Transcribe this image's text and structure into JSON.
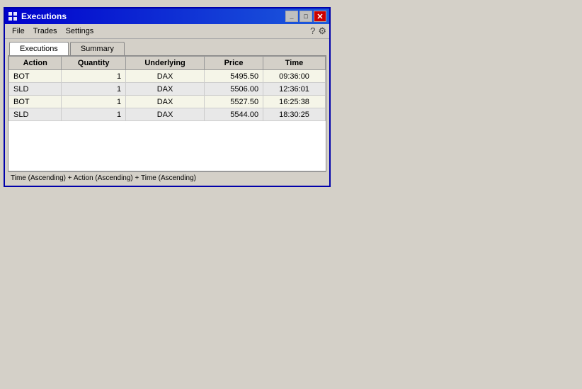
{
  "window": {
    "title": "Executions",
    "icon": "▦"
  },
  "title_buttons": {
    "minimize": "_",
    "maximize": "□",
    "close": "✕"
  },
  "menu": {
    "items": [
      "File",
      "Trades",
      "Settings"
    ],
    "help_icon": "?",
    "tool_icon": "🔧"
  },
  "tabs": [
    {
      "label": "Executions",
      "active": true
    },
    {
      "label": "Summary",
      "active": false
    }
  ],
  "table": {
    "columns": [
      "Action",
      "Quantity",
      "Underlying",
      "Price",
      "Time"
    ],
    "rows": [
      {
        "action": "BOT",
        "quantity": "1",
        "underlying": "DAX",
        "price": "5495.50",
        "time": "09:36:00",
        "style": "odd"
      },
      {
        "action": "SLD",
        "quantity": "1",
        "underlying": "DAX",
        "price": "5506.00",
        "time": "12:36:01",
        "style": "even"
      },
      {
        "action": "BOT",
        "quantity": "1",
        "underlying": "DAX",
        "price": "5527.50",
        "time": "16:25:38",
        "style": "odd"
      },
      {
        "action": "SLD",
        "quantity": "1",
        "underlying": "DAX",
        "price": "5544.00",
        "time": "18:30:25",
        "style": "even"
      }
    ]
  },
  "status_bar": {
    "text": "Time (Ascending) + Action (Ascending) + Time (Ascending)"
  }
}
